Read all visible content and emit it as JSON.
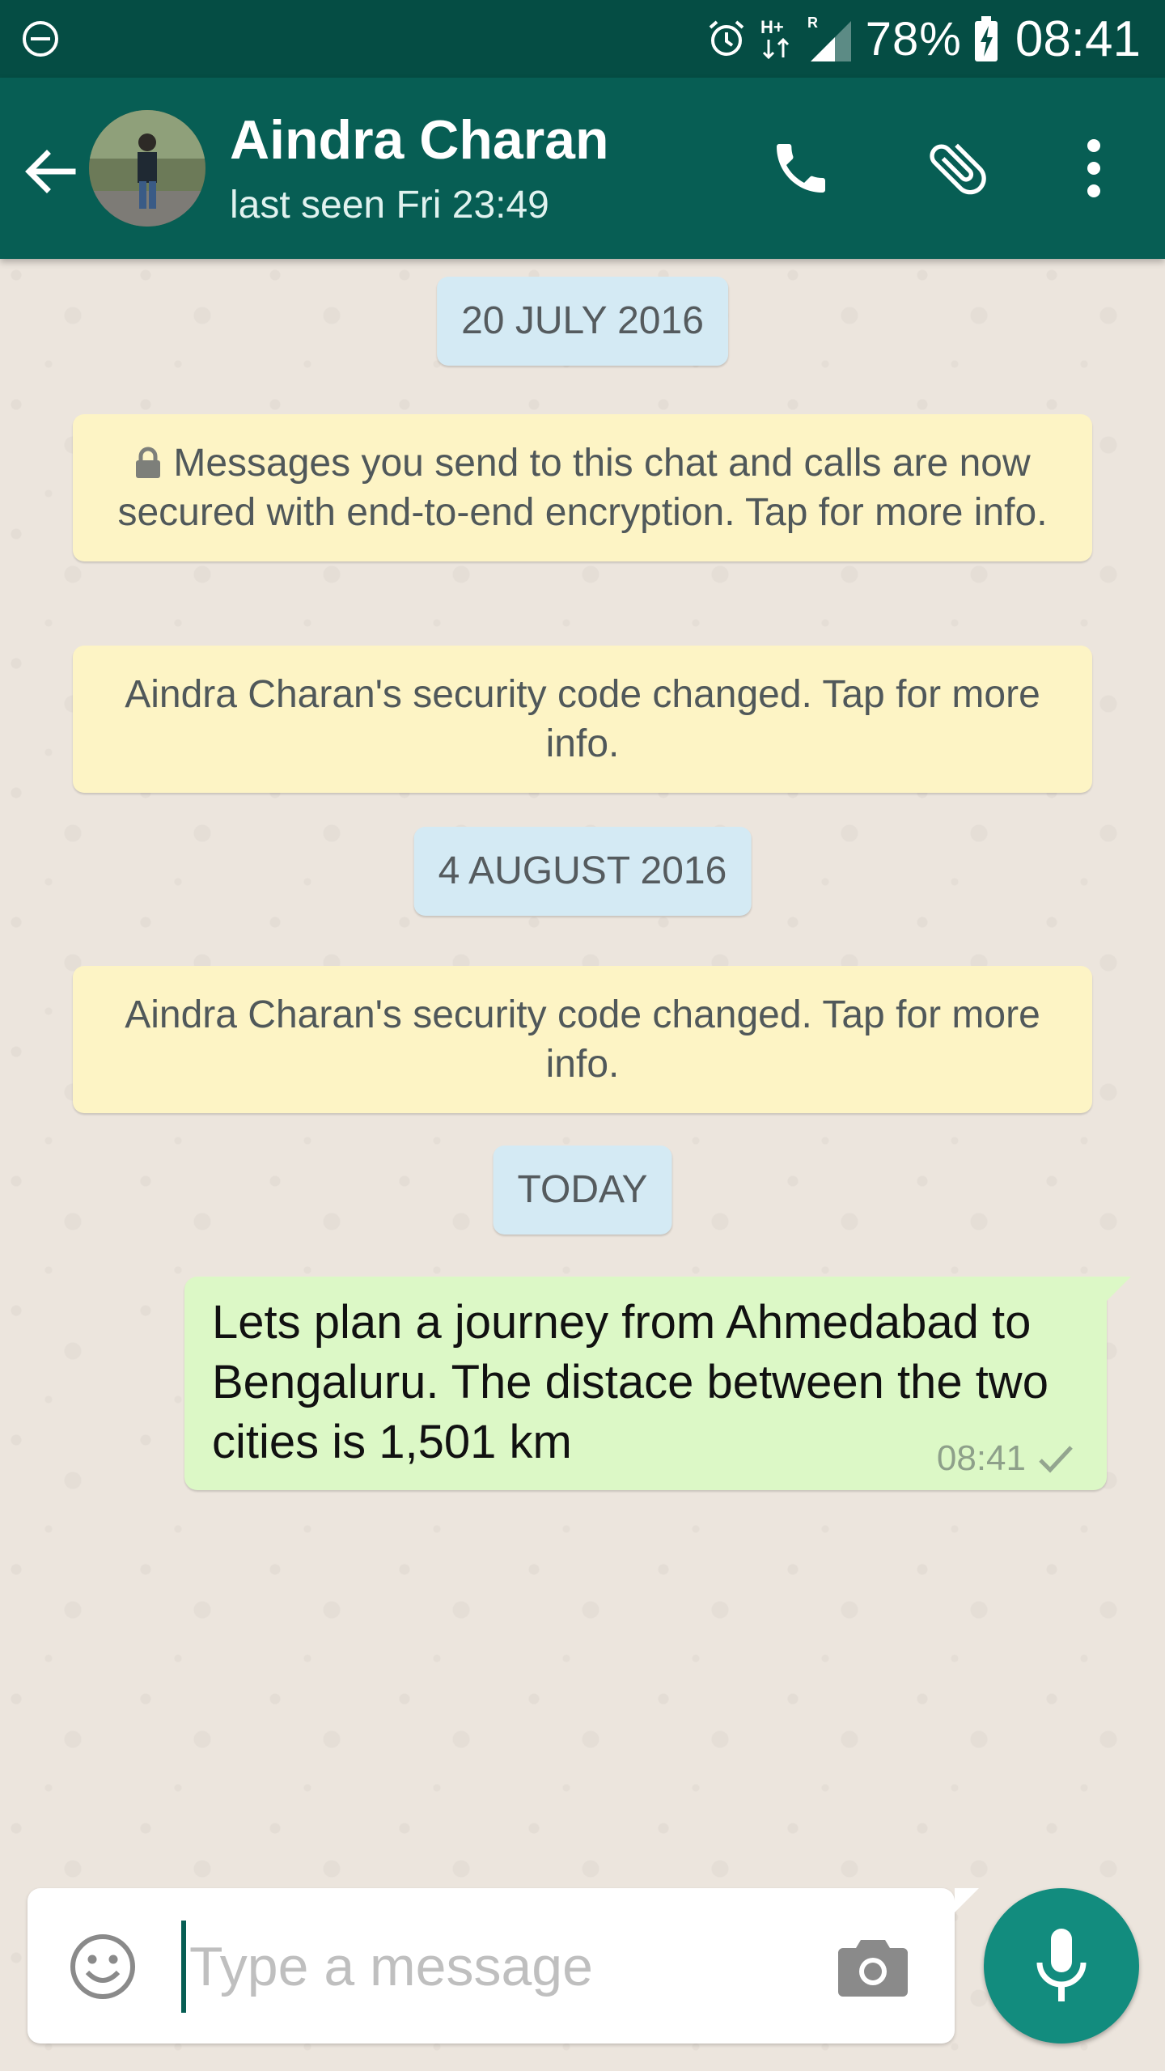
{
  "status_bar": {
    "battery": "78%",
    "time": "08:41",
    "icons": [
      "do-not-disturb-icon",
      "alarm-icon",
      "h-plus-data-icon",
      "signal-icon",
      "battery-charging-icon"
    ]
  },
  "header": {
    "contact_name": "Aindra Charan",
    "last_seen": "last seen Fri 23:49",
    "icons": [
      "back-arrow-icon",
      "phone-icon",
      "paperclip-icon",
      "more-vert-icon"
    ],
    "bar_color": "#075e54"
  },
  "chat": {
    "date_1": "20 JULY 2016",
    "encryption_notice": "Messages you send to this chat and calls are now secured with end-to-end encryption. Tap for more info.",
    "security_notice_1": "Aindra Charan's security code changed. Tap for more info.",
    "date_2": "4 AUGUST 2016",
    "security_notice_2": "Aindra Charan's security code changed. Tap for more info.",
    "date_3": "TODAY",
    "messages": [
      {
        "text": "Lets plan a journey from Ahmedabad to Bengaluru. The distace between the two cities is 1,501 km",
        "time": "08:41",
        "status": "sent-check-icon"
      }
    ]
  },
  "composer": {
    "placeholder": "Type a message",
    "icons": [
      "emoji-icon",
      "camera-icon",
      "microphone-icon"
    ],
    "accent": "#128c7e"
  }
}
